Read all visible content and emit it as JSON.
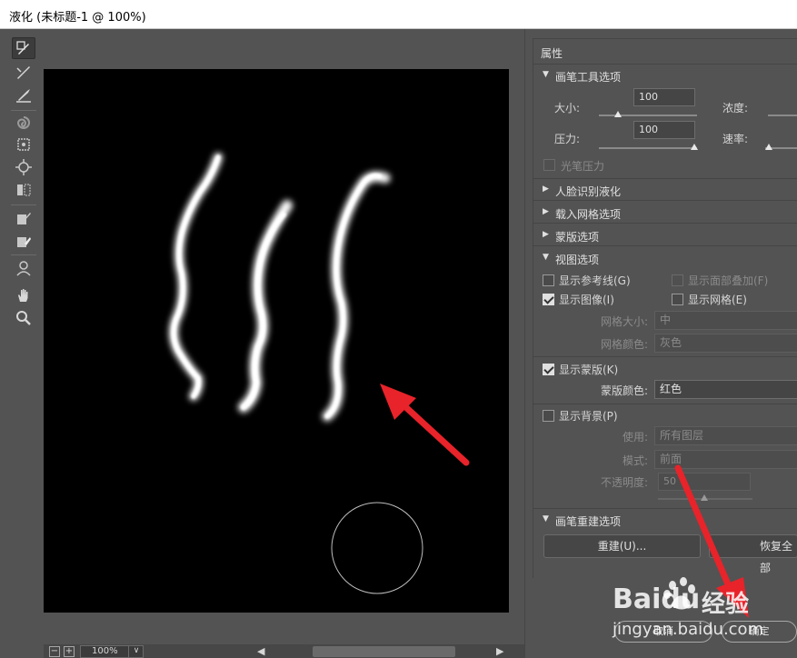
{
  "window": {
    "title": "液化 (未标题-1 @ 100%)"
  },
  "tools": [
    {
      "name": "forward-warp-icon"
    },
    {
      "name": "reconstruct-icon"
    },
    {
      "name": "smooth-icon"
    },
    {
      "name": "twirl-icon"
    },
    {
      "name": "pucker-icon"
    },
    {
      "name": "bloat-icon"
    },
    {
      "name": "push-left-icon"
    },
    {
      "name": "freeze-mask-icon"
    },
    {
      "name": "thaw-mask-icon"
    },
    {
      "name": "face-tool-icon"
    },
    {
      "name": "hand-icon"
    },
    {
      "name": "zoom-icon"
    }
  ],
  "status": {
    "zoom_out": "−",
    "zoom_in": "+",
    "zoom_value": "100%",
    "dropdown": "∨",
    "scroll_left": "◀",
    "scroll_right": "▶"
  },
  "panel": {
    "title": "属性",
    "brush_tool": {
      "header": "画笔工具选项",
      "size_label": "大小:",
      "size_value": "100",
      "density_label": "浓度:",
      "pressure_label": "压力:",
      "pressure_value": "100",
      "rate_label": "速率:",
      "stylus_label": "光笔压力"
    },
    "face_aware": "人脸识别液化",
    "load_mesh": "载入网格选项",
    "mask_options": "蒙版选项",
    "view_options": {
      "header": "视图选项",
      "show_guides": "显示参考线(G)",
      "show_face_overlay": "显示面部叠加(F)",
      "show_image": "显示图像(I)",
      "show_mesh": "显示网格(E)",
      "mesh_size_label": "网格大小:",
      "mesh_size_value": "中",
      "mesh_color_label": "网格颜色:",
      "mesh_color_value": "灰色",
      "show_mask": "显示蒙版(K)",
      "mask_color_label": "蒙版颜色:",
      "mask_color_value": "红色",
      "show_backdrop": "显示背景(P)",
      "use_label": "使用:",
      "use_value": "所有图层",
      "mode_label": "模式:",
      "mode_value": "前面",
      "opacity_label": "不透明度:",
      "opacity_value": "50"
    },
    "brush_reconstruct": {
      "header": "画笔重建选项",
      "rebuild_button": "重建(U)...",
      "restore_all_button": "恢复全部"
    }
  },
  "footer": {
    "cancel": "取消",
    "ok": "确定"
  },
  "watermark": {
    "brand": "Baidu",
    "cn": "经验",
    "url": "jingyan.baidu.com"
  }
}
